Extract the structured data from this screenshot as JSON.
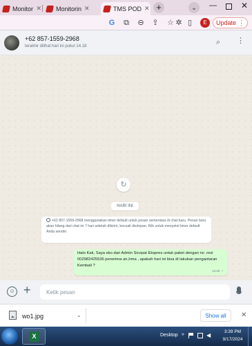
{
  "browser": {
    "tabs": [
      {
        "title": "Monitorin",
        "active": false
      },
      {
        "title": "Monitorin",
        "active": false
      },
      {
        "title": "TMS POD",
        "active": true
      }
    ],
    "new_tab_symbol": "+",
    "toolbar_icons": [
      "google-icon",
      "install-app-icon",
      "zoom-icon",
      "share-icon",
      "bookmark-star-icon",
      "extensions-icon",
      "sidebar-icon"
    ],
    "profile_initial": "E",
    "update_label": "Update"
  },
  "chat": {
    "contact_name": "+62 857-1559-2968",
    "last_seen": "terakhir dilihat hari ini pukul 14.18",
    "date_chip": "HARI INI",
    "system_message": "+62 857-1559-2968 menggunakan timer default untuk pesan sementara di chat baru. Pesan baru akan hilang dari chat ini 7 hari setelah dikirim, kecuali disimpan. Klik untuk menyetel timer default Anda sendiri.",
    "outgoing_message": {
      "text": "Halo Kak, Saya eko dari Admin Sicepat Ekspres untuk paket dengan no .resi 002982425536 penerima an,Irma , apakah hari ini bisa di lakukan pengantaran Kembali ?",
      "time": "13.40",
      "ticks": "✓"
    },
    "composer_placeholder": "Ketik pesan"
  },
  "downloads": {
    "file_name": "wo1.jpg",
    "show_all_label": "Show all"
  },
  "taskbar": {
    "desktop_label": "Desktop",
    "time": "3:39 PM",
    "date": "9/17/2024"
  },
  "colors": {
    "tab_strip": "#e8dbe6",
    "chat_background": "#efeae2",
    "outgoing_bubble": "#d9fdd3",
    "update_accent": "#c5221f",
    "show_all_text": "#1a73e8"
  }
}
